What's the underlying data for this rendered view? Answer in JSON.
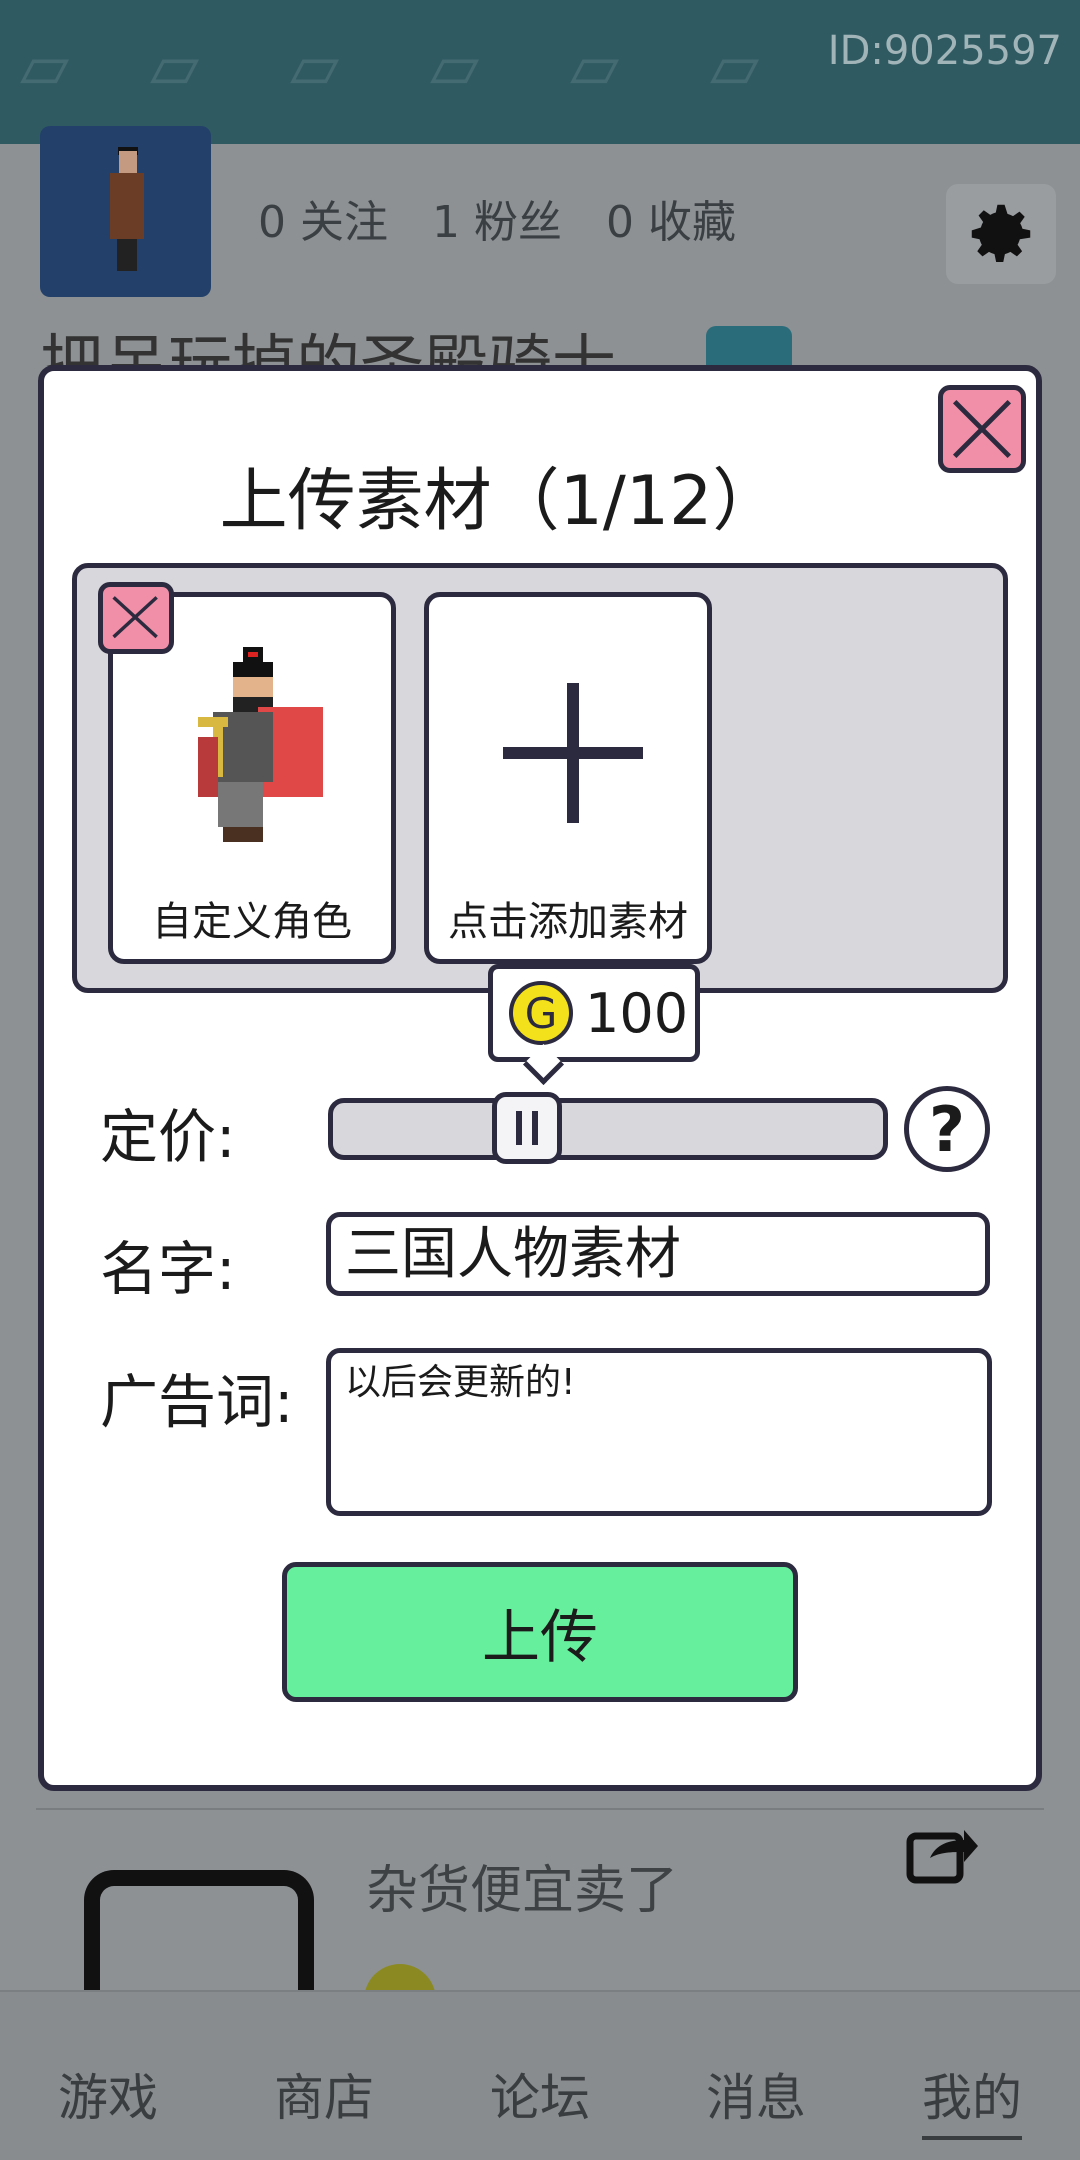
{
  "header": {
    "profile_id": "ID:9025597"
  },
  "profile": {
    "stats": [
      "0 关注",
      "1 粉丝",
      "0 收藏"
    ],
    "title": "把吊玩掉的圣殿骑士"
  },
  "modal": {
    "title": "上传素材（1/12）",
    "assets": [
      {
        "label": "自定义角色"
      },
      {
        "label": "点击添加素材"
      }
    ],
    "price_label": "定价:",
    "price_value": "100",
    "coin_letter": "G",
    "name_label": "名字:",
    "name_value": "三国人物素材",
    "ad_label": "广告词:",
    "ad_value": "以后会更新的!",
    "help_text": "?",
    "upload_label": "上传"
  },
  "background_card": {
    "title": "杂货便宜卖了"
  },
  "bottom_nav": {
    "items": [
      "游戏",
      "商店",
      "论坛",
      "消息",
      "我的"
    ],
    "active_index": 4
  },
  "colors": {
    "modal_close_bg": "#f08fa7",
    "upload_button": "#66ef9d",
    "coin": "#f3e11b",
    "header": "#2f5a62"
  }
}
